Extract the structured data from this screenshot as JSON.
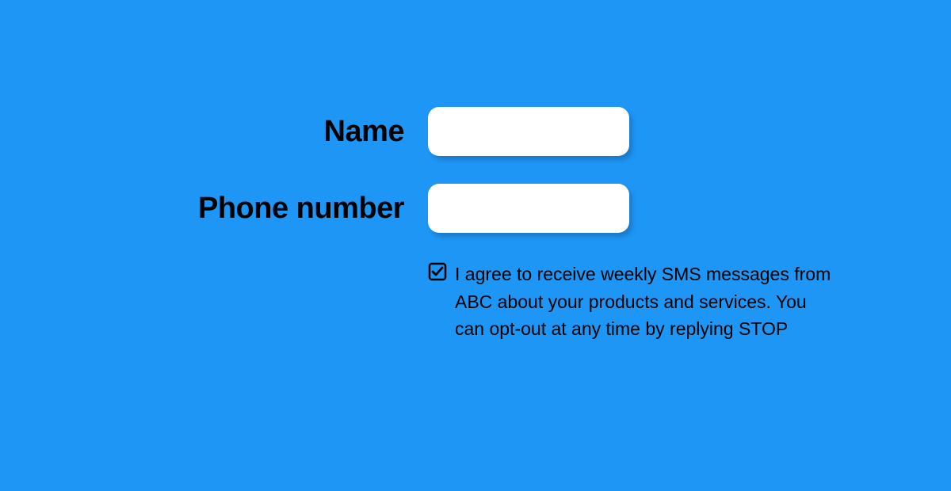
{
  "form": {
    "name": {
      "label": "Name",
      "value": ""
    },
    "phone": {
      "label": "Phone number",
      "value": ""
    },
    "consent": {
      "checked": true,
      "text": "I agree to receive weekly SMS messages from ABC about your products and  services. You can opt-out at any time by replying STOP"
    }
  },
  "colors": {
    "background": "#1E96F5",
    "input_bg": "#FFFFFF",
    "text": "#000000"
  }
}
